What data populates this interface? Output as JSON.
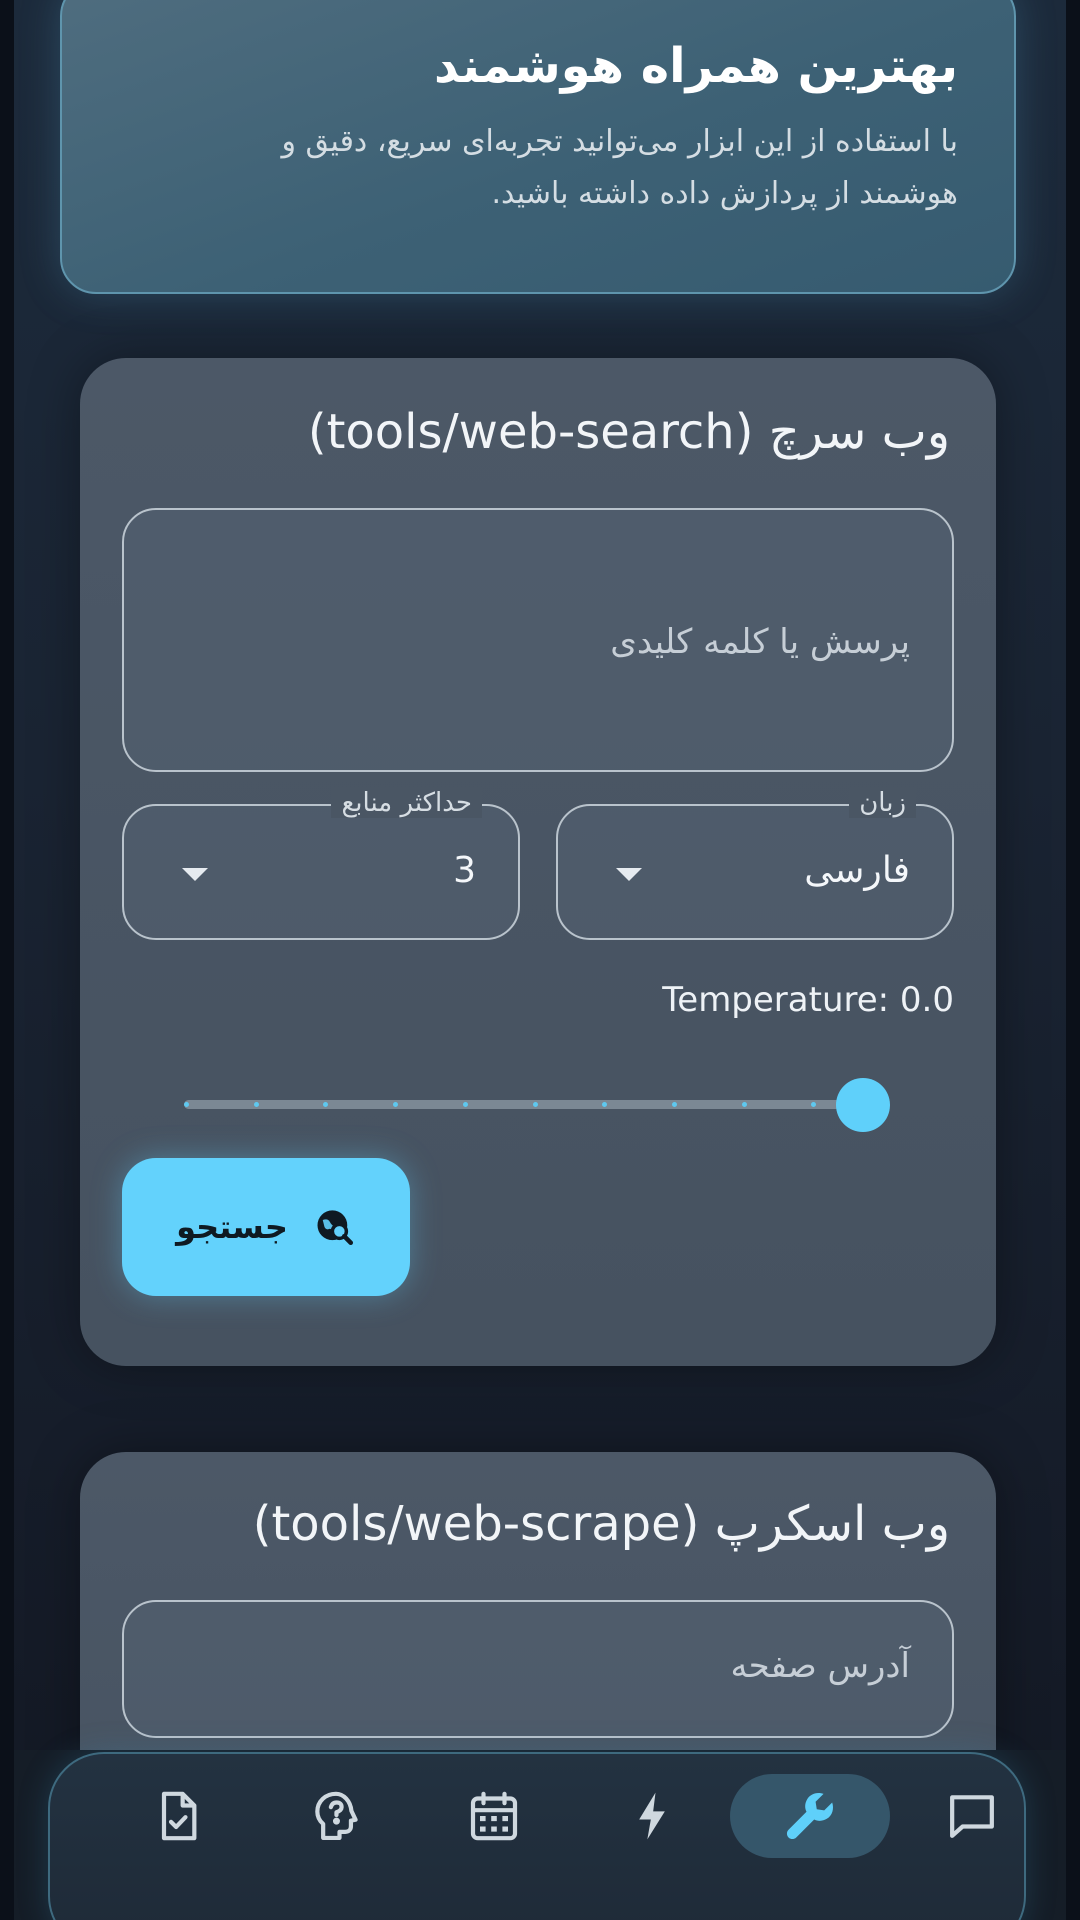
{
  "hero": {
    "title": "بهترین همراه هوشمند",
    "subtitle_line1": "با استفاده از این ابزار می‌توانید تجربه‌ای سریع، دقیق و",
    "subtitle_line2": "هوشمند از پردازش داده داشته باشید."
  },
  "web_search": {
    "title": "وب سرچ (tools/web-search)",
    "query_placeholder": "پرسش یا کلمه کلیدی",
    "language": {
      "label": "زبان",
      "value": "فارسی"
    },
    "max_sources": {
      "label": "حداکثر منابع",
      "value": "3"
    },
    "temperature_label": "Temperature: 0.0",
    "slider": {
      "steps": 10,
      "value_fraction": 1.0
    },
    "search_button_label": "جستجو",
    "search_button_icon": "globe-search-icon"
  },
  "web_scrape": {
    "title": "وب اسکرپ (tools/web-scrape)",
    "url_placeholder": "آدرس صفحه"
  },
  "bottom_nav": {
    "items": [
      {
        "icon": "document-check-icon"
      },
      {
        "icon": "head-question-icon"
      },
      {
        "icon": "calendar-icon"
      },
      {
        "icon": "lightning-icon"
      },
      {
        "icon": "wrench-icon",
        "active": true
      },
      {
        "icon": "chat-bubble-icon"
      }
    ]
  },
  "colors": {
    "accent": "#63d2fc",
    "card": "#4c5867",
    "background": "#0b1019",
    "hero": "#3d6175"
  }
}
